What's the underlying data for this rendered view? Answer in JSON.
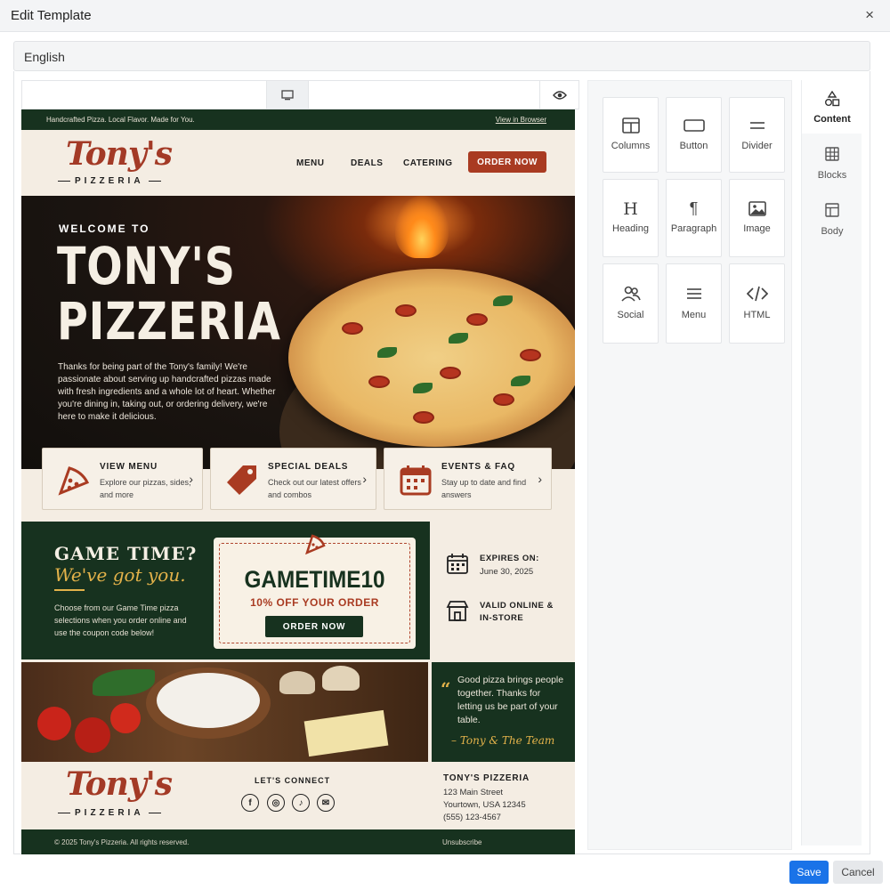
{
  "modal": {
    "title": "Edit Template",
    "close": "×"
  },
  "language": "English",
  "preview": {
    "desktop_icon": "desktop-icon",
    "preview_icon": "eye-icon"
  },
  "email": {
    "topbar": {
      "tagline": "Handcrafted Pizza. Local Flavor. Made for You.",
      "view_browser": "View in Browser"
    },
    "logo": {
      "script": "Tony's",
      "sub": "PIZZERIA"
    },
    "nav": [
      "MENU",
      "DEALS",
      "CATERING"
    ],
    "order_now": "ORDER NOW",
    "hero": {
      "welcome": "WELCOME TO",
      "title_line1": "TONY'S",
      "title_line2": "PIZZERIA",
      "text": "Thanks for being part of the Tony's family! We're passionate about serving up handcrafted pizzas made with fresh ingredients and a whole lot of heart. Whether you're dining in, taking out, or ordering delivery, we're here to make it delicious."
    },
    "cards": [
      {
        "title": "VIEW MENU",
        "text": "Explore our pizzas, sides, and more",
        "icon": "pizza-slice-icon"
      },
      {
        "title": "SPECIAL DEALS",
        "text": "Check out our latest offers and combos",
        "icon": "price-tag-icon"
      },
      {
        "title": "EVENTS & FAQ",
        "text": "Stay up to date and find answers",
        "icon": "calendar-icon"
      }
    ],
    "promo": {
      "title": "GAME TIME?",
      "subtitle": "We've got you.",
      "text": "Choose from our Game Time pizza selections when you order online and use the coupon code below!",
      "code": "GAMETIME10",
      "offer": "10% OFF YOUR ORDER",
      "button": "ORDER NOW",
      "expires_label": "EXPIRES ON:",
      "expires_date": "June 30, 2025",
      "valid": "VALID ONLINE & IN-STORE"
    },
    "quote": {
      "mark": "“",
      "text": "Good pizza brings people together. Thanks for letting us be part of your table.",
      "signature": "– Tony & The Team"
    },
    "footer": {
      "lets_connect": "LET'S CONNECT",
      "social": [
        "f",
        "◎",
        "♪",
        "✉"
      ],
      "name": "TONY'S PIZZERIA",
      "address1": "123 Main Street",
      "address2": "Yourtown, USA 12345",
      "phone": "(555) 123-4567",
      "copyright": "© 2025 Tony's Pizzeria. All rights reserved.",
      "unsubscribe": "Unsubscribe"
    }
  },
  "panel": {
    "tiles": [
      {
        "label": "Columns",
        "icon": "columns-icon"
      },
      {
        "label": "Button",
        "icon": "button-icon"
      },
      {
        "label": "Divider",
        "icon": "divider-icon"
      },
      {
        "label": "Heading",
        "icon": "heading-icon"
      },
      {
        "label": "Paragraph",
        "icon": "paragraph-icon"
      },
      {
        "label": "Image",
        "icon": "image-icon"
      },
      {
        "label": "Social",
        "icon": "social-icon"
      },
      {
        "label": "Menu",
        "icon": "menu-icon"
      },
      {
        "label": "HTML",
        "icon": "html-icon"
      }
    ],
    "tabs": [
      {
        "label": "Content",
        "icon": "shapes-icon"
      },
      {
        "label": "Blocks",
        "icon": "blocks-icon"
      },
      {
        "label": "Body",
        "icon": "body-icon"
      }
    ]
  },
  "actions": {
    "save": "Save",
    "cancel": "Cancel"
  },
  "colors": {
    "primary": "#1a73e8",
    "brand_green": "#17321f",
    "brand_red": "#a93b22",
    "gold": "#e3b24a",
    "cream": "#f4ede3"
  }
}
